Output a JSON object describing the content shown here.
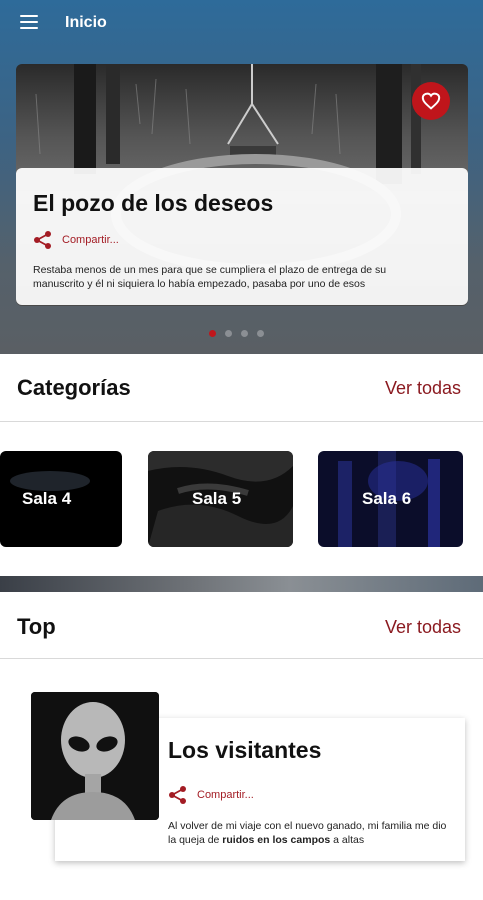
{
  "appbar": {
    "title": "Inicio",
    "menu_icon": "hamburger-menu-icon"
  },
  "carousel": {
    "title": "El pozo de los deseos",
    "share_label": "Compartir...",
    "excerpt": "Restaba menos de un mes para que se cumpliera el plazo de entrega de su manuscrito y él ni siquiera lo había empezado, pasaba por uno de esos",
    "favorite_icon": "heart-icon",
    "slides_count": 4,
    "active_slide": 1
  },
  "categories": {
    "title": "Categorías",
    "see_all": "Ver todas",
    "items": [
      {
        "label": "Sala 4"
      },
      {
        "label": "Sala 5"
      },
      {
        "label": "Sala 6"
      }
    ]
  },
  "top": {
    "title": "Top",
    "see_all": "Ver todas",
    "item": {
      "title": "Los visitantes",
      "share_label": "Compartir...",
      "excerpt_part1": "Al volver de mi viaje con el nuevo ganado, mi familia me dio la queja de ",
      "excerpt_bold": "ruidos en los campos",
      "excerpt_part2": " a altas"
    }
  },
  "colors": {
    "accent": "#c0151b",
    "link": "#8b1a20",
    "appbar": "#2e6b9a"
  }
}
